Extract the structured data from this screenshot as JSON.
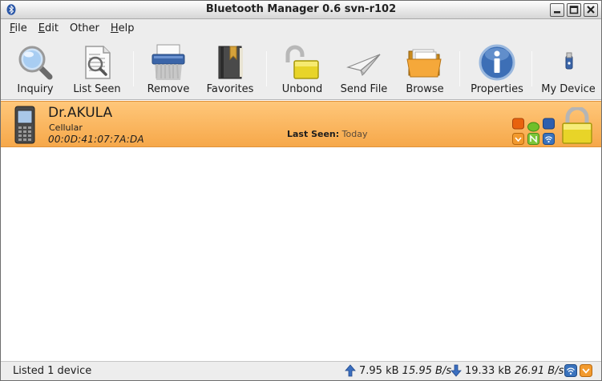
{
  "window": {
    "title": "Bluetooth Manager 0.6 svn-r102"
  },
  "menu": {
    "file": {
      "ul": "F",
      "rest": "ile"
    },
    "edit": {
      "ul": "E",
      "rest": "dit"
    },
    "other": {
      "ul": "",
      "rest": "Other"
    },
    "help": {
      "ul": "H",
      "rest": "elp"
    }
  },
  "toolbar": {
    "inquiry": "Inquiry",
    "list_seen": "List Seen",
    "remove": "Remove",
    "favorites": "Favorites",
    "unbond": "Unbond",
    "send_file": "Send File",
    "browse": "Browse",
    "properties": "Properties",
    "my_device": "My Device"
  },
  "devices": [
    {
      "name": "Dr.AKULA",
      "type": "Cellular",
      "mac": "00:0D:41:07:7A:DA",
      "last_seen_label": "Last Seen:",
      "last_seen_value": "Today",
      "selected": true,
      "row_color": "#f9b35e"
    }
  ],
  "status": {
    "message": "Listed 1 device",
    "upload_total": "7.95 kB",
    "upload_rate": "15.95 B/s",
    "download_total": "19.33 kB",
    "download_rate": "26.91 B/s"
  },
  "colors": {
    "accent_blue": "#3d6fb6",
    "selection_orange": "#f9b35e",
    "lock_yellow": "#e8d428"
  }
}
